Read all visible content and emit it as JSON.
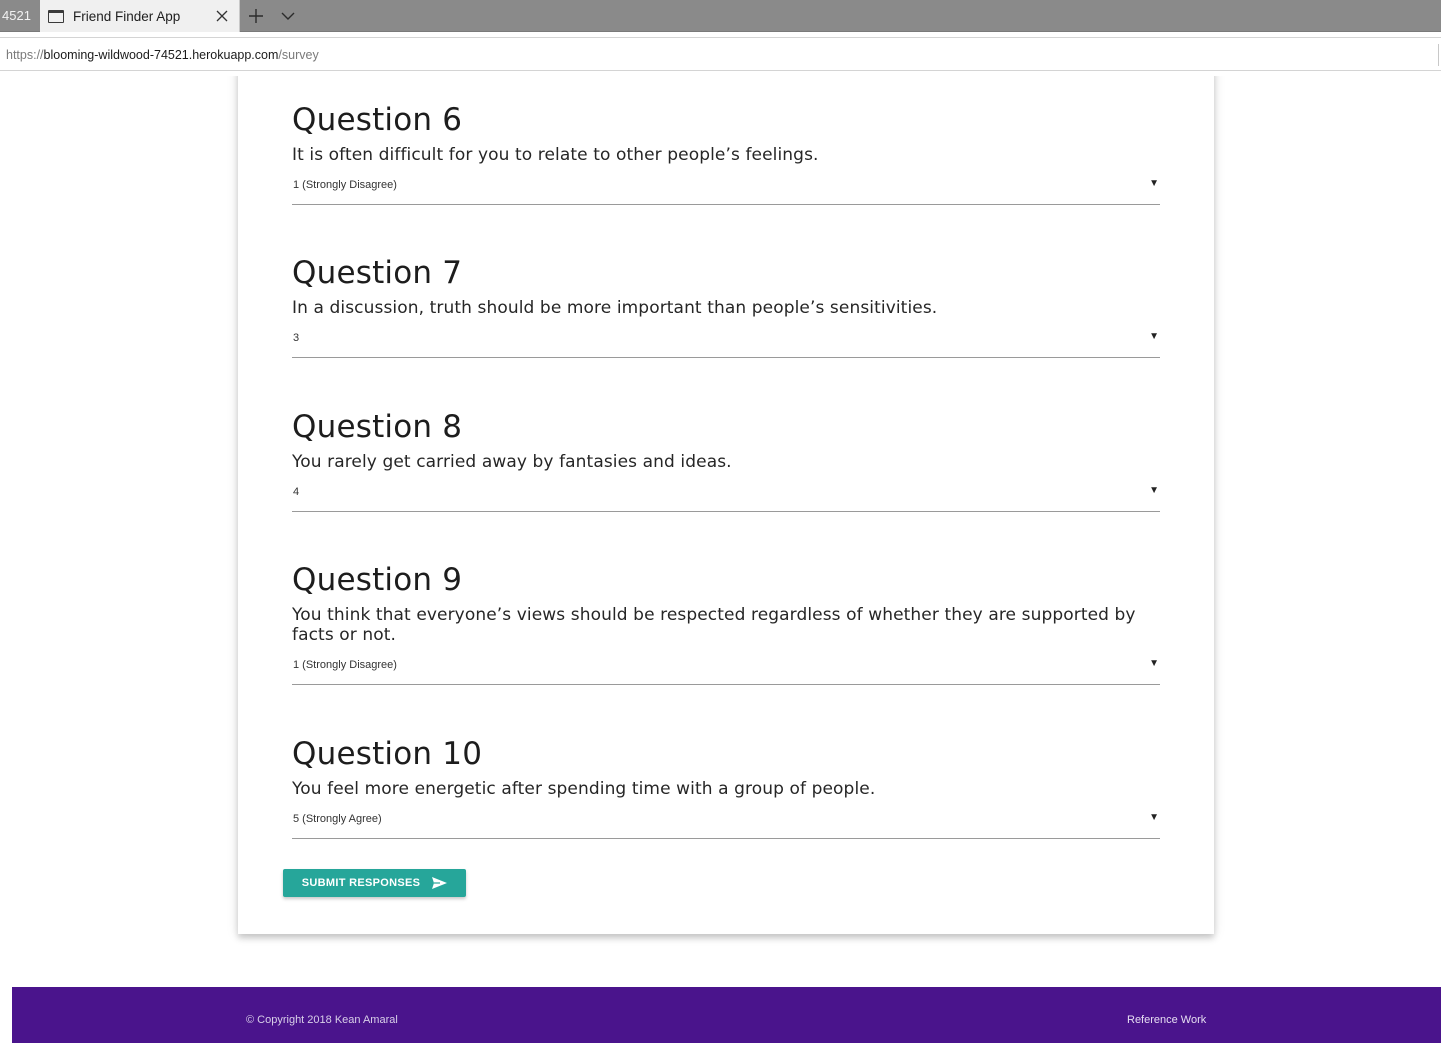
{
  "browser": {
    "prev_tab_stub": "4521",
    "active_tab_title": "Friend Finder App",
    "url": {
      "protocol": "https://",
      "host": "blooming-wildwood-74521.herokuapp.com",
      "path": "/survey"
    }
  },
  "survey": {
    "questions": [
      {
        "title": "Question 6",
        "text": "It is often difficult for you to relate to other people’s feelings.",
        "selected": "1 (Strongly Disagree)"
      },
      {
        "title": "Question 7",
        "text": "In a discussion, truth should be more important than people’s sensitivities.",
        "selected": "3"
      },
      {
        "title": "Question 8",
        "text": "You rarely get carried away by fantasies and ideas.",
        "selected": "4"
      },
      {
        "title": "Question 9",
        "text": "You think that everyone’s views should be respected regardless of whether they are supported by facts or not.",
        "selected": "1 (Strongly Disagree)"
      },
      {
        "title": "Question 10",
        "text": "You feel more energetic after spending time with a group of people.",
        "selected": "5 (Strongly Agree)"
      }
    ],
    "caret_glyph": "▼",
    "submit_label": "SUBMIT RESPONSES",
    "submit_icon": "send-icon"
  },
  "footer": {
    "copyright": "© Copyright 2018 Kean Amaral",
    "link": "Reference Work"
  },
  "colors": {
    "accent": "#26a69a",
    "footer_bg": "#4a148c"
  }
}
